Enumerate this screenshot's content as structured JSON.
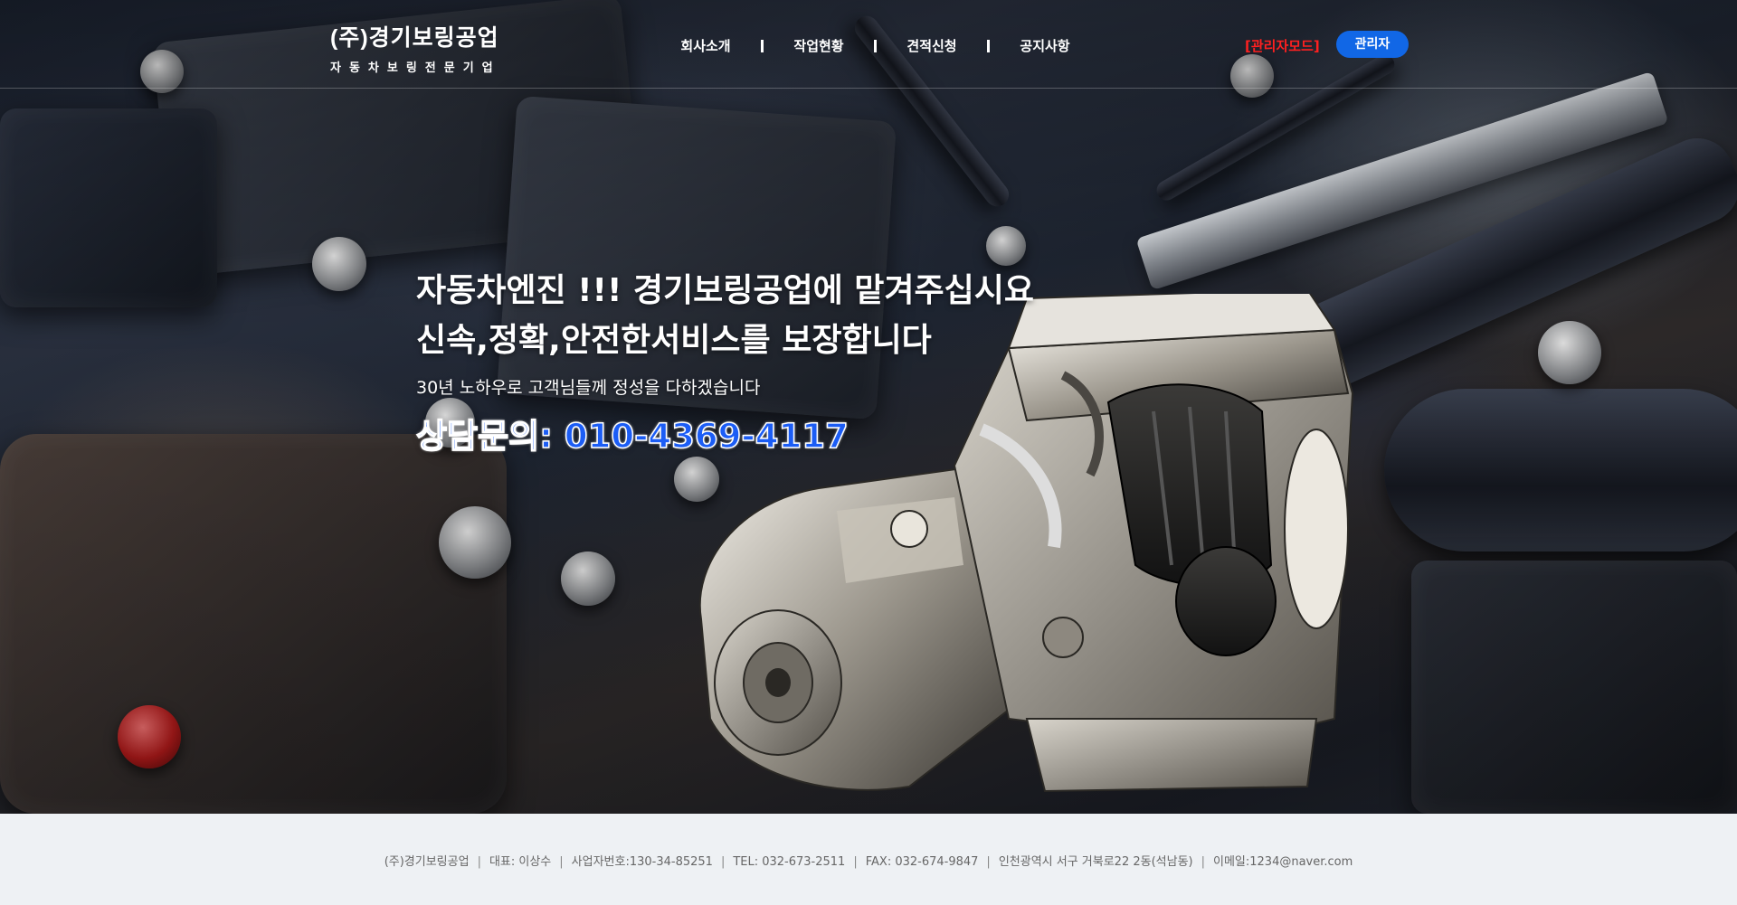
{
  "header": {
    "logo_main": "(주)경기보링공업",
    "logo_sub": "자동차보링전문기업",
    "nav": [
      "회사소개",
      "작업현황",
      "견적신청",
      "공지사항"
    ],
    "admin_mode": "[관리자모드]",
    "admin_button": "관리자"
  },
  "hero": {
    "headline_1": "자동차엔진 !!! 경기보링공업에 맡겨주십시요",
    "headline_2": "신속,정확,안전한서비스를 보장합니다",
    "subline": "30년 노하우로 고객님들께 정성을 다하겠습니다",
    "contact": "상담문의: 010-4369-4117"
  },
  "footer": {
    "company": "(주)경기보링공업",
    "ceo": "대표: 이상수",
    "biz_no": "사업자번호:130-34-85251",
    "tel": "TEL: 032-673-2511",
    "fax": "FAX: 032-674-9847",
    "address": "인천광역시 서구 거북로22 2동(석남동)",
    "email": "이메일:1234@naver.com"
  },
  "colors": {
    "accent_blue": "#1167e6",
    "contact_blue": "#1c5df5",
    "admin_red": "#ff2020",
    "footer_bg": "#eef1f4"
  }
}
